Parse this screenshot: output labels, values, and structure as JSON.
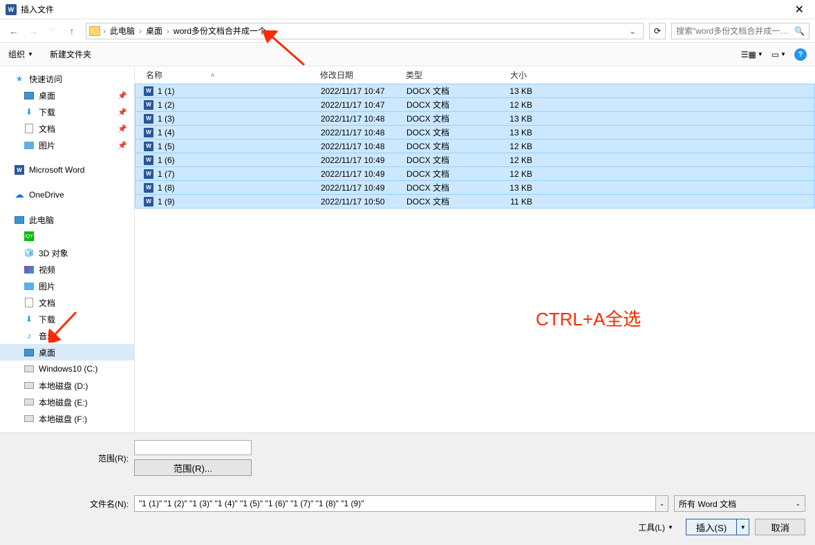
{
  "title": "插入文件",
  "breadcrumb": {
    "items": [
      "此电脑",
      "桌面",
      "word多份文档合并成一个"
    ],
    "sep": "›"
  },
  "search_placeholder": "搜索\"word多份文档合并成一…",
  "toolbar": {
    "organize": "组织",
    "newfolder": "新建文件夹"
  },
  "sidebar": {
    "quickaccess": "快速访问",
    "desktop": "桌面",
    "downloads": "下载",
    "documents": "文档",
    "pictures": "图片",
    "msword": "Microsoft Word",
    "onedrive": "OneDrive",
    "thispc": "此电脑",
    "iqiyi": "",
    "threeD": "3D 对象",
    "videos": "视频",
    "pictures2": "图片",
    "documents2": "文档",
    "downloads2": "下载",
    "music": "音乐",
    "desktop2": "桌面",
    "osdrive": "Windows10 (C:)",
    "ddrive": "本地磁盘 (D:)",
    "edrive": "本地磁盘 (E:)",
    "fdrive": "本地磁盘 (F:)"
  },
  "columns": {
    "name": "名称",
    "date": "修改日期",
    "type": "类型",
    "size": "大小"
  },
  "files": [
    {
      "name": "1 (1)",
      "date": "2022/11/17 10:47",
      "type": "DOCX 文档",
      "size": "13 KB"
    },
    {
      "name": "1 (2)",
      "date": "2022/11/17 10:47",
      "type": "DOCX 文档",
      "size": "12 KB"
    },
    {
      "name": "1 (3)",
      "date": "2022/11/17 10:48",
      "type": "DOCX 文档",
      "size": "13 KB"
    },
    {
      "name": "1 (4)",
      "date": "2022/11/17 10:48",
      "type": "DOCX 文档",
      "size": "13 KB"
    },
    {
      "name": "1 (5)",
      "date": "2022/11/17 10:48",
      "type": "DOCX 文档",
      "size": "12 KB"
    },
    {
      "name": "1 (6)",
      "date": "2022/11/17 10:49",
      "type": "DOCX 文档",
      "size": "12 KB"
    },
    {
      "name": "1 (7)",
      "date": "2022/11/17 10:49",
      "type": "DOCX 文档",
      "size": "12 KB"
    },
    {
      "name": "1 (8)",
      "date": "2022/11/17 10:49",
      "type": "DOCX 文档",
      "size": "13 KB"
    },
    {
      "name": "1 (9)",
      "date": "2022/11/17 10:50",
      "type": "DOCX 文档",
      "size": "11 KB"
    }
  ],
  "annotation_text": "CTRL+A全选",
  "bottom": {
    "range_label": "范围(R):",
    "range_button": "范围(R)...",
    "filename_label": "文件名(N):",
    "filename_value": "\"1 (1)\" \"1 (2)\" \"1 (3)\" \"1 (4)\" \"1 (5)\" \"1 (6)\" \"1 (7)\" \"1 (8)\" \"1 (9)\"",
    "filetype": "所有 Word 文档",
    "tools": "工具(L)",
    "insert": "插入(S)",
    "cancel": "取消"
  }
}
